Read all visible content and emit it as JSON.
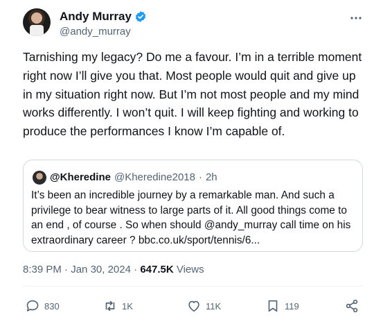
{
  "author": {
    "name": "Andy Murray",
    "handle": "@andy_murray"
  },
  "icons": {
    "verified": "verified-badge-icon",
    "more": "more-options-icon"
  },
  "tweet": {
    "text": "Tarnishing my legacy? Do me a favour. I’m in a terrible moment right now I’ll give you that. Most people would quit and give up in my situation right now. But I’m not most people and my mind works differently. I won’t quit. I will keep fighting and working to produce the performances I know I’m capable of."
  },
  "quoted": {
    "name": "@Kheredine",
    "handle": "@Kheredine2018",
    "sep": "·",
    "time": "2h",
    "text": "It’s been an incredible journey by a remarkable man. And such a privilege to bear witness to large parts of it.  All good things come to an end , of course .  So when should @andy_murray call time on his extraordinary career ? bbc.co.uk/sport/tennis/6..."
  },
  "meta": {
    "time": "8:39 PM",
    "sep1": "·",
    "date": "Jan 30, 2024",
    "sep2": "·",
    "views_count": "647.5K",
    "views_label": "Views"
  },
  "actions": {
    "reply": "830",
    "retweet": "1K",
    "like": "11K",
    "bookmark": "119"
  },
  "colors": {
    "verified": "#1d9bf0",
    "secondary_text": "#536471",
    "border": "#cfd9de"
  }
}
